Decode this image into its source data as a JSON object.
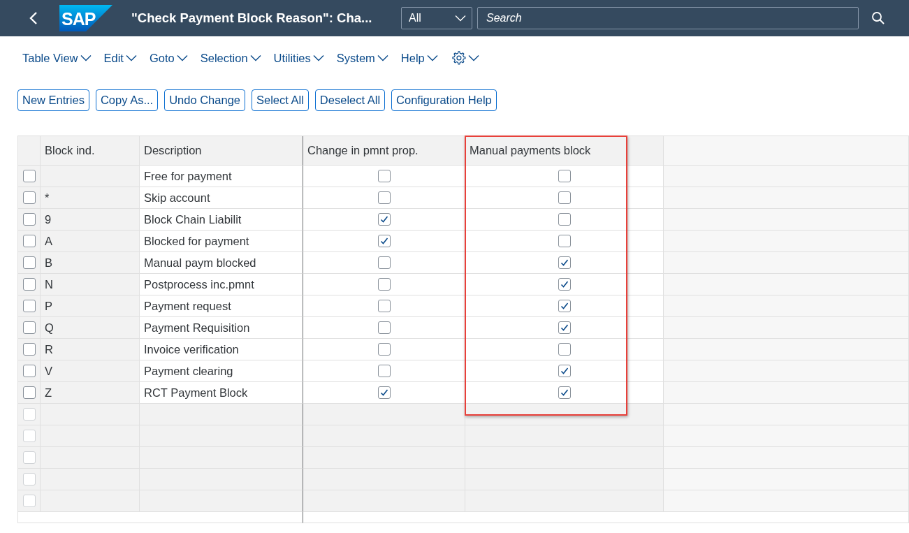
{
  "shell": {
    "logo_text": "SAP",
    "title": "\"Check Payment Block Reason\": Cha...",
    "scope": "All",
    "search_placeholder": "Search"
  },
  "menu": [
    {
      "kind": "text",
      "label": "Table View"
    },
    {
      "kind": "text",
      "label": "Edit"
    },
    {
      "kind": "text",
      "label": "Goto"
    },
    {
      "kind": "text",
      "label": "Selection"
    },
    {
      "kind": "text",
      "label": "Utilities"
    },
    {
      "kind": "text",
      "label": "System"
    },
    {
      "kind": "text",
      "label": "Help"
    },
    {
      "kind": "settings"
    }
  ],
  "toolbar": [
    "New Entries",
    "Copy As...",
    "Undo Change",
    "Select All",
    "Deselect All",
    "Configuration Help"
  ],
  "table": {
    "columns": [
      {
        "label": "Block ind.",
        "highlighted": false
      },
      {
        "label": "Description",
        "highlighted": false
      },
      {
        "label": "Change in pmnt prop.",
        "highlighted": false
      },
      {
        "label": "Manual payments block",
        "highlighted": true
      }
    ],
    "rows": [
      {
        "selected": false,
        "description": "Free for payment",
        "change_in_pmnt_prop": false,
        "manual_payments_block": false
      },
      {
        "selected": false,
        "block_ind": "*",
        "description": "Skip account",
        "change_in_pmnt_prop": false,
        "manual_payments_block": false
      },
      {
        "selected": false,
        "block_ind": "9",
        "description": "Block Chain Liabilit",
        "change_in_pmnt_prop": true,
        "manual_payments_block": false
      },
      {
        "selected": false,
        "block_ind": "A",
        "description": "Blocked for payment",
        "change_in_pmnt_prop": true,
        "manual_payments_block": false
      },
      {
        "selected": false,
        "block_ind": "B",
        "description": "Manual paym blocked",
        "change_in_pmnt_prop": false,
        "manual_payments_block": true
      },
      {
        "selected": false,
        "block_ind": "N",
        "description": "Postprocess inc.pmnt",
        "change_in_pmnt_prop": false,
        "manual_payments_block": true
      },
      {
        "selected": false,
        "block_ind": "P",
        "description": "Payment request",
        "change_in_pmnt_prop": false,
        "manual_payments_block": true
      },
      {
        "selected": false,
        "block_ind": "Q",
        "description": "Payment Requisition",
        "change_in_pmnt_prop": false,
        "manual_payments_block": true
      },
      {
        "selected": false,
        "block_ind": "R",
        "description": "Invoice verification",
        "change_in_pmnt_prop": false,
        "manual_payments_block": false
      },
      {
        "selected": false,
        "block_ind": "V",
        "description": "Payment clearing",
        "change_in_pmnt_prop": false,
        "manual_payments_block": true
      },
      {
        "selected": false,
        "block_ind": "Z",
        "description": "RCT Payment Block",
        "change_in_pmnt_prop": true,
        "manual_payments_block": true
      }
    ],
    "blank_rows": [
      {
        "selected": false
      },
      {
        "selected": false
      },
      {
        "selected": false
      },
      {
        "selected": false
      },
      {
        "selected": false
      }
    ]
  }
}
